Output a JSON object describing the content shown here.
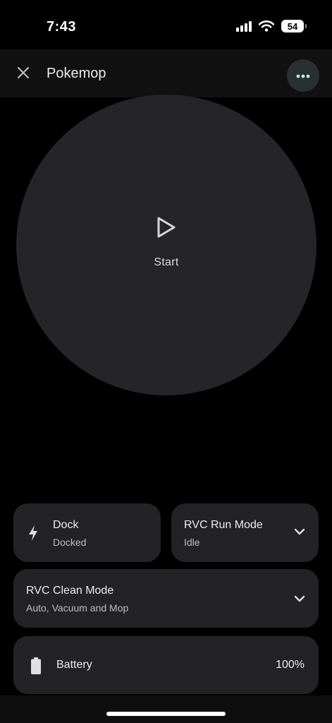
{
  "status_bar": {
    "time": "7:43",
    "battery_level": "54",
    "icons": [
      "signal-icon",
      "wifi-icon",
      "battery-icon"
    ]
  },
  "app_bar": {
    "title": "Pokemop",
    "close_icon": "close-icon",
    "more_icon": "more-horizontal-icon"
  },
  "start": {
    "label": "Start",
    "icon": "play-icon"
  },
  "tiles": {
    "dock": {
      "title": "Dock",
      "subtitle": "Docked",
      "icon": "bolt-icon"
    },
    "run_mode": {
      "title": "RVC Run Mode",
      "subtitle": "Idle",
      "icon": "chevron-down-icon"
    },
    "clean_mode": {
      "title": "RVC Clean Mode",
      "subtitle": "Auto, Vacuum and Mop",
      "icon": "chevron-down-icon"
    },
    "battery": {
      "title": "Battery",
      "value": "100%",
      "icon": "battery-icon"
    }
  },
  "colors": {
    "background": "#000000",
    "app_bar": "#111111",
    "tile": "#232325",
    "circle": "#252527",
    "more_button": "#2a302f",
    "more_dots": "#cfe6df"
  }
}
